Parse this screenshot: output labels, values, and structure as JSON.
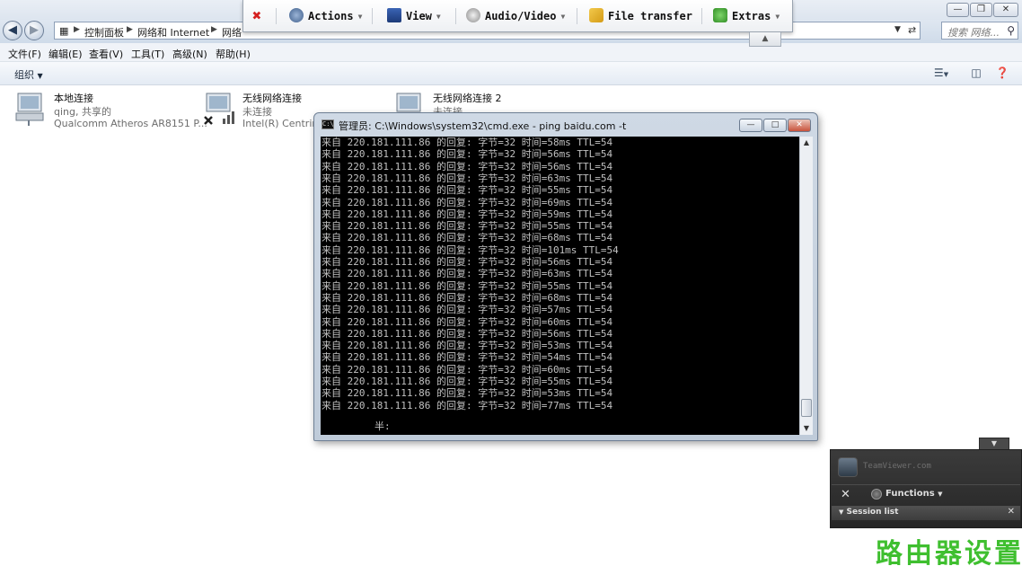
{
  "breadcrumb": {
    "items": [
      "控制面板",
      "网络和 Internet",
      "网络"
    ]
  },
  "search": {
    "placeholder": "搜索 网络..."
  },
  "menubar": {
    "items": [
      "文件(F)",
      "编辑(E)",
      "查看(V)",
      "工具(T)",
      "高级(N)",
      "帮助(H)"
    ]
  },
  "commandbar": {
    "organize": "组织"
  },
  "connections": [
    {
      "name": "本地连接",
      "status": "qing, 共享的",
      "adapter": "Qualcomm Atheros AR8151 P...",
      "icon": "network-adapter-icon",
      "state": "connected"
    },
    {
      "name": "无线网络连接",
      "status": "未连接",
      "adapter": "Intel(R) Centrino",
      "icon": "wireless-adapter-icon",
      "state": "disconnected"
    },
    {
      "name": "无线网络连接 2",
      "status": "未连接",
      "adapter": "",
      "icon": "wireless-adapter-icon",
      "state": "disconnected"
    }
  ],
  "teamviewer_toolbar": {
    "close_icon": "close-icon",
    "actions": "Actions",
    "view": "View",
    "audio_video": "Audio/Video",
    "file_transfer": "File transfer",
    "extras": "Extras"
  },
  "cmd": {
    "title": "管理员: C:\\Windows\\system32\\cmd.exe - ping  baidu.com -t",
    "icon_text": "C:\\",
    "lines": [
      "来自 220.181.111.86 的回复: 字节=32 时间=58ms TTL=54",
      "来自 220.181.111.86 的回复: 字节=32 时间=56ms TTL=54",
      "来自 220.181.111.86 的回复: 字节=32 时间=56ms TTL=54",
      "来自 220.181.111.86 的回复: 字节=32 时间=63ms TTL=54",
      "来自 220.181.111.86 的回复: 字节=32 时间=55ms TTL=54",
      "来自 220.181.111.86 的回复: 字节=32 时间=69ms TTL=54",
      "来自 220.181.111.86 的回复: 字节=32 时间=59ms TTL=54",
      "来自 220.181.111.86 的回复: 字节=32 时间=55ms TTL=54",
      "来自 220.181.111.86 的回复: 字节=32 时间=68ms TTL=54",
      "来自 220.181.111.86 的回复: 字节=32 时间=101ms TTL=54",
      "来自 220.181.111.86 的回复: 字节=32 时间=56ms TTL=54",
      "来自 220.181.111.86 的回复: 字节=32 时间=63ms TTL=54",
      "来自 220.181.111.86 的回复: 字节=32 时间=55ms TTL=54",
      "来自 220.181.111.86 的回复: 字节=32 时间=68ms TTL=54",
      "来自 220.181.111.86 的回复: 字节=32 时间=57ms TTL=54",
      "来自 220.181.111.86 的回复: 字节=32 时间=60ms TTL=54",
      "来自 220.181.111.86 的回复: 字节=32 时间=56ms TTL=54",
      "来自 220.181.111.86 的回复: 字节=32 时间=53ms TTL=54",
      "来自 220.181.111.86 的回复: 字节=32 时间=54ms TTL=54",
      "来自 220.181.111.86 的回复: 字节=32 时间=60ms TTL=54",
      "来自 220.181.111.86 的回复: 字节=32 时间=55ms TTL=54",
      "来自 220.181.111.86 的回复: 字节=32 时间=53ms TTL=54",
      "来自 220.181.111.86 的回复: 字节=32 时间=77ms TTL=54"
    ],
    "ime_line": "半:"
  },
  "teamviewer_panel": {
    "brand": "TeamViewer.com",
    "functions": "Functions",
    "session_list": "Session list"
  },
  "watermark": "路由器设置",
  "colors": {
    "console_bg": "#000000",
    "console_text": "#c0c0c0",
    "watermark": "#3fbf2f",
    "tv_panel": "#2e2e2e"
  }
}
